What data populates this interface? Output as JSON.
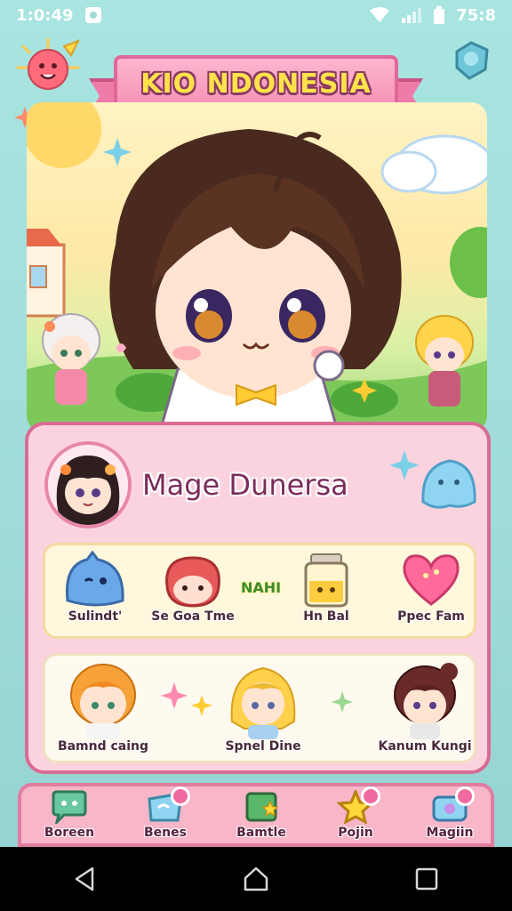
{
  "status_bar": {
    "time_left": "1:0:49",
    "time_right": "75:8"
  },
  "banner": {
    "title": "KIO NDONESIA"
  },
  "profile": {
    "name": "Mage Dunersa"
  },
  "items": {
    "extra_label": "NAHI",
    "slots": [
      {
        "label": "Sulindt'",
        "icon": "blue-slime-icon"
      },
      {
        "label": "Se Goa Tme",
        "icon": "red-creature-icon"
      },
      {
        "label": "Hn Bal",
        "icon": "honey-jar-icon"
      },
      {
        "label": "Ppec Fam",
        "icon": "heart-icon"
      }
    ]
  },
  "friends": [
    {
      "label": "Bamnd caing",
      "icon": "friend-orange-avatar"
    },
    {
      "label": "Spnel Dine",
      "icon": "friend-blonde-avatar"
    },
    {
      "label": "Kanum Kungi",
      "icon": "friend-brown-avatar"
    }
  ],
  "bottom_nav": [
    {
      "label": "Boreen",
      "icon": "chat-bubble-icon"
    },
    {
      "label": "Benes",
      "icon": "gift-icon"
    },
    {
      "label": "Bamtle",
      "icon": "map-icon"
    },
    {
      "label": "Pojin",
      "icon": "star-icon"
    },
    {
      "label": "Magiin",
      "icon": "mailbox-icon"
    }
  ],
  "colors": {
    "background": "#a8e4e0",
    "banner_pink": "#f48fb4",
    "banner_text": "#ffe24a",
    "card_pink": "#fbd3df",
    "card_border": "#d96b93",
    "nav_pink": "#f8b6c8"
  }
}
